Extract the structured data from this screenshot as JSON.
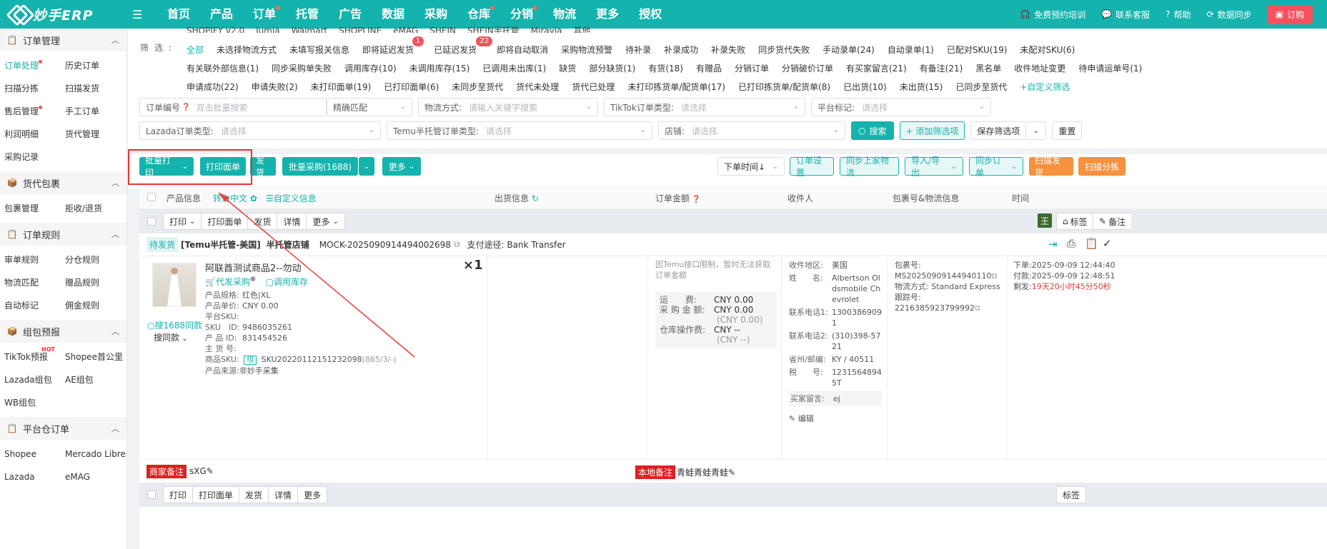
{
  "brand": {
    "name": "妙手ERP"
  },
  "nav": {
    "items": [
      "首页",
      "产品",
      "订单",
      "托管",
      "广告",
      "数据",
      "采购",
      "仓库",
      "分销",
      "物流",
      "更多",
      "授权"
    ],
    "right": {
      "training": "免费预约培训",
      "support": "联系客服",
      "help": "帮助",
      "sync": "数据同步",
      "order": "订购"
    }
  },
  "sidebar": {
    "sections": [
      {
        "title": "订单管理",
        "items": [
          "订单处理",
          "历史订单",
          "扫描分拣",
          "扫描发货",
          "售后管理",
          "手工订单",
          "利润明细",
          "货代管理",
          "采购记录"
        ]
      },
      {
        "title": "货代包裹",
        "items": [
          "包裹管理",
          "拒收/退货"
        ]
      },
      {
        "title": "订单规则",
        "items": [
          "审单规则",
          "分仓规则",
          "物流匹配",
          "赠品规则",
          "自动标记",
          "佣金规则"
        ]
      },
      {
        "title": "组包预报",
        "items": [
          "TikTok预报",
          "Shopee首公里",
          "Lazada组包",
          "AE组包",
          "WB组包"
        ]
      },
      {
        "title": "平台仓订单",
        "items": [
          "Shopee",
          "Mercado Libre",
          "Lazada",
          "eMAG"
        ]
      }
    ],
    "hot_label": "HOT"
  },
  "filters": {
    "cut_row": [
      "SHOPIFY v2.0",
      "Jumia",
      "Walmart",
      "SHOPLINE",
      "eMAG",
      "SHEIN",
      "SHEIN半托管",
      "Miravia",
      "其他"
    ],
    "label": "筛选:",
    "row1": [
      "全部",
      "未选择物流方式",
      "未填写报关信息",
      "即将延迟发货",
      "已延迟发货",
      "即将自动取消",
      "采购物流预警",
      "待补录",
      "补录成功",
      "补录失败",
      "同步货代失败",
      "手动录单(24)",
      "自动录单(1)",
      "已配对SKU(19)",
      "未配对SKU(6)"
    ],
    "row1_badges": {
      "delay_soon": "1",
      "delayed": "22"
    },
    "row2": [
      "有关联外部信息(1)",
      "同步采购单失败",
      "调用库存(10)",
      "未调用库存(15)",
      "已调用未出库(1)",
      "缺货",
      "部分缺货(1)",
      "有货(18)",
      "有赠品",
      "分销订单",
      "分销破价订单",
      "有买家留言(21)",
      "有备注(21)",
      "黑名单",
      "收件地址变更",
      "待申请运单号(1)"
    ],
    "row3": [
      "申请成功(22)",
      "申请失败(2)",
      "未打印面单(19)",
      "已打印面单(6)",
      "未同步至货代",
      "货代未处理",
      "货代已处理",
      "未打印拣货单/配货单(17)",
      "已打印拣货单/配货单(8)",
      "已出货(10)",
      "未出货(15)",
      "已同步至货代"
    ],
    "custom": "+自定义筛选",
    "order_no": {
      "label": "订单编号",
      "placeholder": "双击批量搜索"
    },
    "match": "精确匹配",
    "logistics": {
      "label": "物流方式:",
      "placeholder": "请输入关键字搜索"
    },
    "tiktok_type": {
      "label": "TikTok订单类型:",
      "placeholder": "请选择"
    },
    "platform_mark": {
      "label": "平台标记:",
      "placeholder": "请选择"
    },
    "lazada_type": {
      "label": "Lazada订单类型:",
      "placeholder": "请选择"
    },
    "temu_type": {
      "label": "Temu半托管订单类型:",
      "placeholder": "请选择"
    },
    "store": {
      "label": "店铺:",
      "placeholder": "请选择"
    },
    "search": "搜索",
    "add_filter": "+ 添加筛选项",
    "save_filter": "保存筛选项",
    "reset": "重置"
  },
  "toolbar": {
    "batch_print": "批量打印",
    "print_label": "打印面单",
    "ship": "发货",
    "batch_purchase": "批量采购(1688)",
    "more": "更多",
    "sort": "下单时间↓",
    "order_settings": "订单设置",
    "sync_carrier": "同步上家物流",
    "import_export": "导入/导出",
    "sync_orders": "同步订单",
    "scan_ship": "扫描发货",
    "scan_sort": "扫描分拣"
  },
  "table": {
    "headers": {
      "product": "产品信息",
      "translate": "转为中文",
      "custom_info": "自定义信息",
      "shipping": "出货信息",
      "amount": "订单金额",
      "receiver": "收件人",
      "package": "包裹号&物流信息",
      "time": "时间"
    },
    "subbar": {
      "print": "打印",
      "print_label": "打印面单",
      "ship": "发货",
      "detail": "详情",
      "more": "更多",
      "king": "王",
      "tags": "标签",
      "remark": "备注"
    }
  },
  "order": {
    "status": "待发货",
    "shop_type": "[Temu半托管-美国]",
    "shop_name": "半托管店铺",
    "order_id": "MOCK-2025090914494002698",
    "payment": "支付途径: Bank Transfer",
    "product_title": "阿联酋测试商品2--勿动",
    "qty": "×1",
    "purchase_link": "代发采购",
    "stock_link": "调用库存",
    "search_1688": "搜1688同款",
    "search_same": "搜同款",
    "attrs": [
      {
        "k": "产品规格:",
        "v": "红色|XL"
      },
      {
        "k": "产品单价:",
        "v": "CNY 0.00"
      },
      {
        "k": "平台SKU:",
        "v": ""
      },
      {
        "k": "SKU　ID:",
        "v": "9486035261"
      },
      {
        "k": "产 品 ID:",
        "v": "831454526"
      },
      {
        "k": "主 货 号:",
        "v": ""
      }
    ],
    "goods_sku_label": "商品SKU:",
    "goods_sku_group": "组",
    "goods_sku": "SKU20220112151232098",
    "goods_sku_extra": "(865/3/-)",
    "source_label": "产品来源:",
    "source": "非妙手采集",
    "amount_note": "因Temu接口限制，暂时无法获取订单金额",
    "freight": {
      "k": "运　　费:",
      "v": "CNY 0.00"
    },
    "purchase_amt": {
      "k": "采 购 金 额:",
      "v": "CNY 0.00",
      "sub": "(CNY 0.00)"
    },
    "warehouse_fee": {
      "k": "仓库操作费:",
      "v": "CNY --",
      "sub": "(CNY --)"
    },
    "receiver": {
      "region_k": "收件地区:",
      "region": "美国",
      "name_k": "姓　　名:",
      "name": "Albertson Oldsmobile Chevrolet",
      "phone1_k": "联系电话1:",
      "phone1": "13003869091",
      "phone2_k": "联系电话2:",
      "phone2": "(310)398-5721",
      "state_k": "省州/邮编:",
      "state": "KY / 40511",
      "tax_k": "税　　号:",
      "tax": "12315648945T",
      "msg_k": "买家留言:",
      "msg": "ej",
      "edit": "编辑"
    },
    "package": {
      "no_k": "包裹号:",
      "no": "MS20250909144940110",
      "method_k": "物流方式:",
      "method": "Standard Express",
      "track_k": "跟踪号:",
      "track": "2216385923799992"
    },
    "time": {
      "order_k": "下单:",
      "order": "2025-09-09 12:44:40",
      "paid_k": "付款:",
      "paid": "2025-09-09 12:48:51",
      "remain_k": "剩发:",
      "remain": "19天20小时45分50秒"
    },
    "merchant_note_tag": "商家备注",
    "merchant_note": "sXG",
    "local_note_tag": "本地备注",
    "local_note": "青蛙青蛙青蛙"
  },
  "colors": {
    "brand": "#14b3ad",
    "orange": "#f7913d",
    "red": "#e02020"
  }
}
